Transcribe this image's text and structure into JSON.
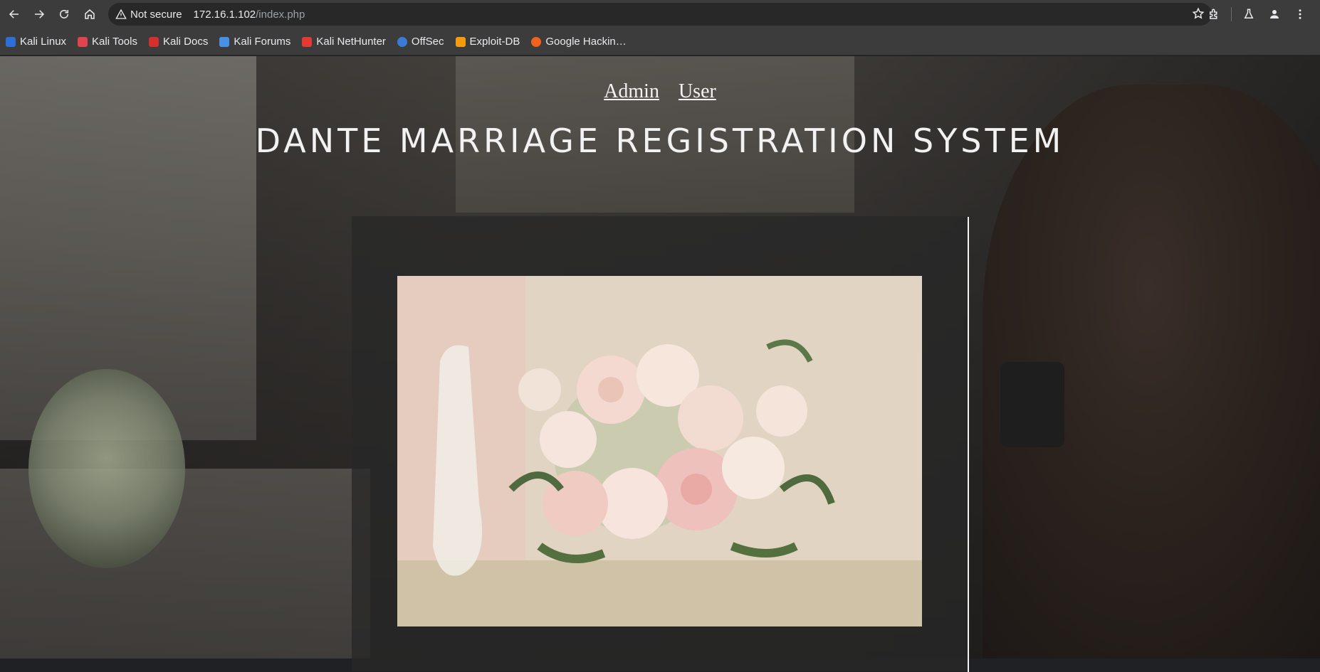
{
  "browser": {
    "security_label": "Not secure",
    "url_host": "172.16.1.102",
    "url_path": "/index.php",
    "icons": [
      "back-icon",
      "forward-icon",
      "reload-icon",
      "home-icon",
      "warning-icon",
      "star-icon",
      "extensions-icon",
      "labs-icon",
      "profile-icon"
    ]
  },
  "bookmarks": [
    {
      "label": "Kali Linux",
      "color": "#2d6fd6"
    },
    {
      "label": "Kali Tools",
      "color": "#e0454f"
    },
    {
      "label": "Kali Docs",
      "color": "#d32f2f"
    },
    {
      "label": "Kali Forums",
      "color": "#4a8fe7"
    },
    {
      "label": "Kali NetHunter",
      "color": "#e53935"
    },
    {
      "label": "OffSec",
      "color": "#3a7bd5"
    },
    {
      "label": "Exploit-DB",
      "color": "#f39c12"
    },
    {
      "label": "Google Hackin…",
      "color": "#f0631b"
    }
  ],
  "page": {
    "nav": {
      "admin": "Admin",
      "user": "User"
    },
    "title": "DANTE MARRIAGE REGISTRATION SYSTEM"
  }
}
